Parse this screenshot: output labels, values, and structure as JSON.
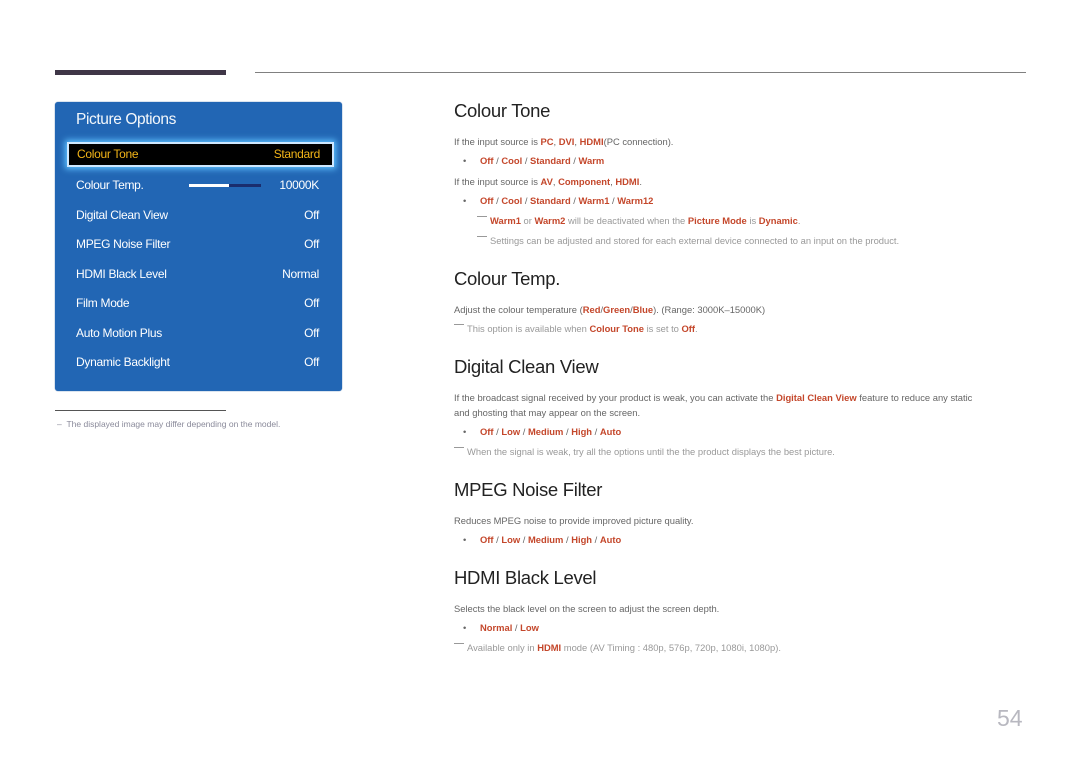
{
  "panel": {
    "title": "Picture Options",
    "items": [
      {
        "label": "Colour Tone",
        "value": "Standard",
        "selected": true
      },
      {
        "label": "Colour Temp.",
        "value": "10000K",
        "slider_fraction": 0.55
      },
      {
        "label": "Digital Clean View",
        "value": "Off"
      },
      {
        "label": "MPEG Noise Filter",
        "value": "Off"
      },
      {
        "label": "HDMI Black Level",
        "value": "Normal"
      },
      {
        "label": "Film Mode",
        "value": "Off"
      },
      {
        "label": "Auto Motion Plus",
        "value": "Off"
      },
      {
        "label": "Dynamic Backlight",
        "value": "Off"
      }
    ]
  },
  "footnote": "The displayed image may differ depending on the model.",
  "sections": {
    "colour_tone": {
      "title": "Colour Tone",
      "line1_pre": "If the input source is ",
      "line1_a": "PC",
      "line1_b": "DVI",
      "line1_c": "HDMI",
      "line1_post": "(PC connection).",
      "opts1": [
        "Off",
        "Cool",
        "Standard",
        "Warm"
      ],
      "line2_pre": "If the input source is ",
      "line2_a": "AV",
      "line2_b": "Component",
      "line2_c": "HDMI",
      "line2_post": ".",
      "opts2": [
        "Off",
        "Cool",
        "Standard",
        "Warm1",
        "Warm12"
      ],
      "note1": {
        "a": "Warm1",
        "t1": " or ",
        "b": "Warm2",
        "t2": " will be deactivated when the ",
        "c": "Picture Mode",
        "t3": " is ",
        "d": "Dynamic",
        "t4": "."
      },
      "note2": "Settings can be adjusted and stored for each external device connected to an input on the product."
    },
    "colour_temp": {
      "title": "Colour Temp.",
      "desc_pre": "Adjust the colour temperature (",
      "red": "Red",
      "green": "Green",
      "blue": "Blue",
      "desc_post": "). (Range: 3000K–15000K)",
      "note": {
        "t1": "This option is available when ",
        "a": "Colour Tone",
        "t2": " is set to ",
        "b": "Off",
        "t3": "."
      }
    },
    "digital_clean_view": {
      "title": "Digital Clean View",
      "desc_pre": "If the broadcast signal received by your product is weak, you can activate the ",
      "desc_hl": "Digital Clean View",
      "desc_post": " feature to reduce any static",
      "desc_line2": "and ghosting that may appear on the screen.",
      "opts": [
        "Off",
        "Low",
        "Medium",
        "High",
        "Auto"
      ],
      "note": "When the signal is weak, try all the options until the the product displays the best picture."
    },
    "mpeg_noise_filter": {
      "title": "MPEG Noise Filter",
      "desc": "Reduces MPEG noise to provide improved picture quality.",
      "opts": [
        "Off",
        "Low",
        "Medium",
        "High",
        "Auto"
      ]
    },
    "hdmi_black_level": {
      "title": "HDMI Black Level",
      "desc": "Selects the black level on the screen to adjust the screen depth.",
      "opts": [
        "Normal",
        "Low"
      ],
      "note": {
        "t1": "Available only in ",
        "a": "HDMI",
        "t2": " mode (AV Timing : 480p, 576p, 720p, 1080i, 1080p)."
      }
    }
  },
  "page_number": "54",
  "colors": {
    "accent": "#c4472b",
    "panel": "#2266b4",
    "selected_text": "#f2b418"
  }
}
